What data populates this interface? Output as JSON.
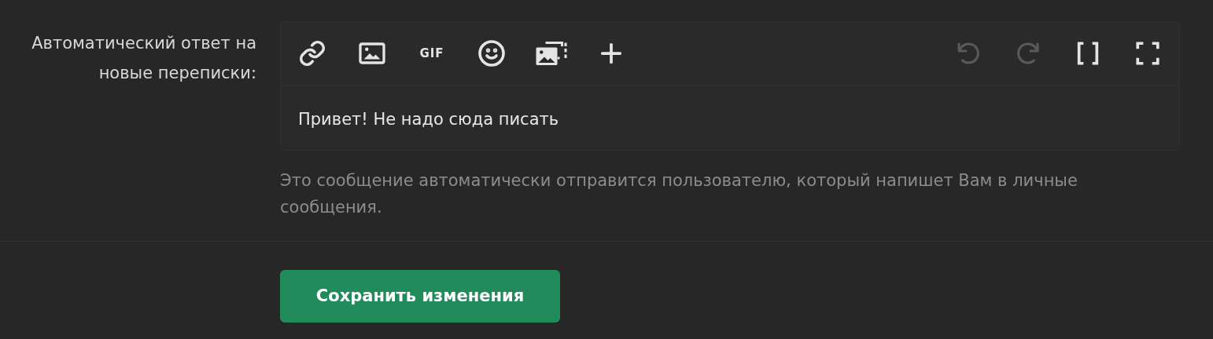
{
  "field": {
    "label": "Автоматический ответ на новые переписки:",
    "toolbar": [
      {
        "kind": "link",
        "disabled": false
      },
      {
        "kind": "image",
        "disabled": false
      },
      {
        "kind": "gif",
        "text": "GIF",
        "disabled": false
      },
      {
        "kind": "emoji",
        "disabled": false
      },
      {
        "kind": "gallery",
        "disabled": false
      },
      {
        "kind": "plus",
        "disabled": false
      }
    ],
    "toolbar_right": [
      {
        "kind": "undo",
        "disabled": true
      },
      {
        "kind": "redo",
        "disabled": true
      },
      {
        "kind": "brackets",
        "disabled": false
      },
      {
        "kind": "fullscreen",
        "disabled": false
      }
    ],
    "value": "Привет! Не надо сюда писать",
    "hint": "Это сообщение автоматически отправится пользователю, который напишет Вам в личные сообщения."
  },
  "save_button": "Сохранить изменения"
}
